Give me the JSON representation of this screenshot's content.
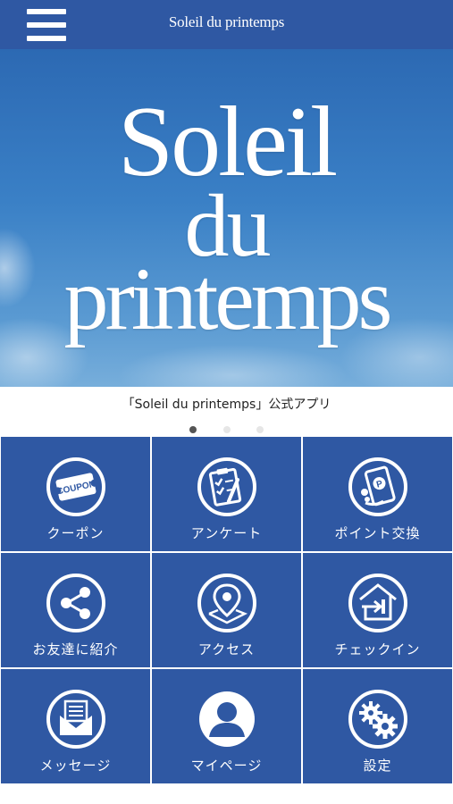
{
  "header": {
    "title": "Soleil du printemps",
    "menu_icon": "hamburger-menu-icon"
  },
  "hero": {
    "line1": "Soleil",
    "line2": "du",
    "line3": "printemps"
  },
  "caption": "「Soleil du printemps」公式アプリ",
  "carousel": {
    "count": 3,
    "active_index": 0
  },
  "menu": {
    "items": [
      {
        "label": "クーポン",
        "icon": "coupon-icon",
        "icon_text": "COUPON"
      },
      {
        "label": "アンケート",
        "icon": "survey-clipboard-icon"
      },
      {
        "label": "ポイント交換",
        "icon": "point-phone-icon",
        "icon_text": "P"
      },
      {
        "label": "お友達に紹介",
        "icon": "share-icon"
      },
      {
        "label": "アクセス",
        "icon": "map-pin-icon"
      },
      {
        "label": "チェックイン",
        "icon": "check-in-icon"
      },
      {
        "label": "メッセージ",
        "icon": "message-envelope-icon"
      },
      {
        "label": "マイページ",
        "icon": "user-icon"
      },
      {
        "label": "設定",
        "icon": "settings-gears-icon"
      }
    ]
  },
  "colors": {
    "brand": "#2f58a3",
    "tile_text": "#ffffff"
  }
}
